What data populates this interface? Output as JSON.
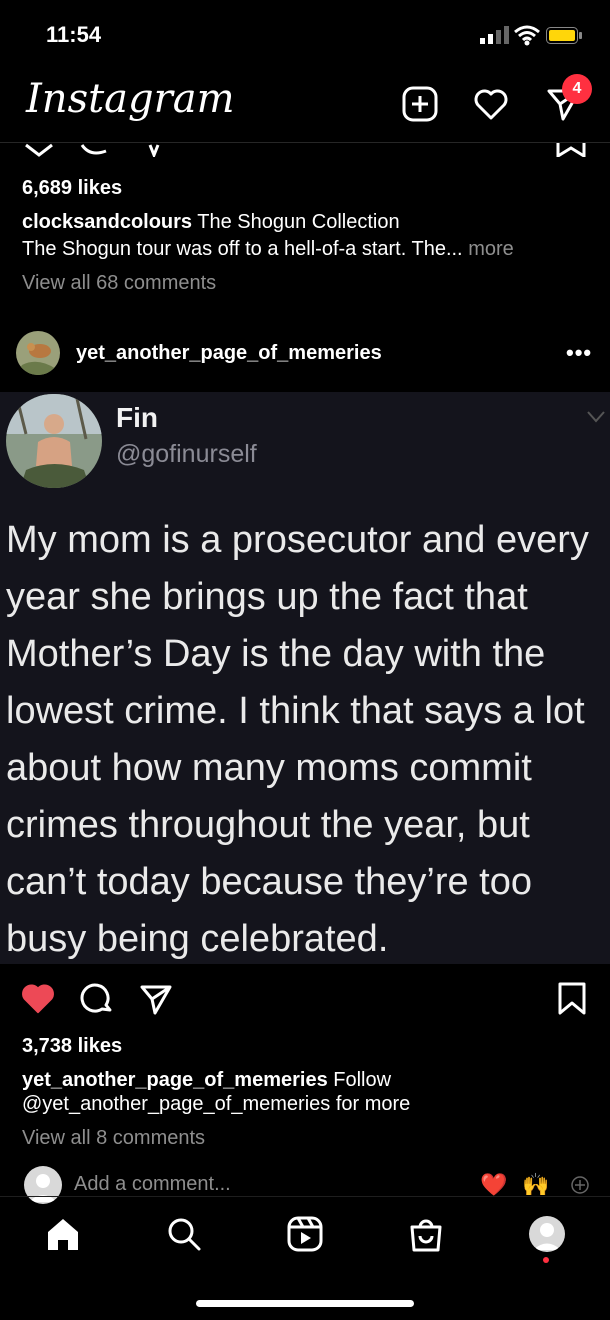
{
  "status_bar": {
    "time": "11:54"
  },
  "header": {
    "logo": "Instagram",
    "notifications_badge": "4"
  },
  "post1": {
    "likes": "6,689 likes",
    "username": "clocksandcolours",
    "caption_title": "The Shogun Collection",
    "caption_text": "The Shogun tour was off to a hell-of-a start. The...",
    "more_label": "more",
    "view_comments": "View all 68 comments"
  },
  "post2": {
    "username": "yet_another_page_of_memeries",
    "options": "•••",
    "tweet": {
      "name": "Fin",
      "handle": "@gofinurself",
      "text": "My mom is a prosecutor and every year she brings up the fact that Mother’s Day is the day with the lowest crime. I think that says a lot about how many moms commit crimes throughout the year, but can’t today because they’re too busy being celebrated."
    },
    "likes": "3,738 likes",
    "caption_user": "yet_another_page_of_memeries",
    "caption_text": "Follow",
    "caption_line2": "@yet_another_page_of_memeries for more",
    "view_comments": "View all 8 comments",
    "add_comment_placeholder": "Add a comment...",
    "quick_emojis": [
      "❤️",
      "🙌"
    ]
  },
  "colors": {
    "like_red": "#ed4956",
    "badge_red": "#ff3040",
    "muted": "#8e8e8e",
    "tweet_bg": "#14141c"
  },
  "icons": [
    "new-post-icon",
    "heart-icon",
    "direct-message-icon",
    "comment-icon",
    "share-icon",
    "bookmark-icon",
    "home-icon",
    "search-icon",
    "reels-icon",
    "shop-icon"
  ]
}
